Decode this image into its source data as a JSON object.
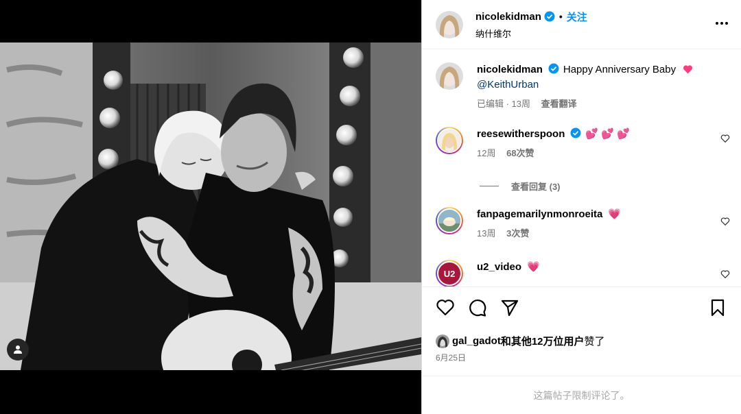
{
  "post": {
    "author": "nicolekidman",
    "follow_label": "关注",
    "location": "纳什维尔",
    "caption_text": "Happy Anniversary Baby",
    "caption_mention": "@KeithUrban",
    "caption_meta_edited": "已编辑 · 13周",
    "caption_meta_translate": "查看翻译",
    "separator_dot": "•"
  },
  "comments": [
    {
      "user": "reesewitherspoon",
      "text": "💕 💕 💕",
      "age": "12周",
      "likes": "68次赞",
      "replies": "查看回复 (3)"
    },
    {
      "user": "fanpagemarilynmonroeita",
      "text": "💗",
      "age": "13周",
      "likes": "3次赞"
    },
    {
      "user": "u2_video",
      "text": "💗",
      "avatar_text": "U2"
    }
  ],
  "likes": {
    "user": "gal_gadot",
    "suffix": "和其他12万位用户赞了",
    "date": "6月25日"
  },
  "footer": {
    "text": "这篇帖子限制评论了。"
  },
  "colors": {
    "accent": "#0095f6",
    "verified": "#0095f6",
    "heart": "#ff3040",
    "muted": "#737373"
  },
  "icons": [
    "user-tag-icon",
    "verified-icon",
    "more-icon",
    "heart-icon",
    "comment-icon",
    "share-icon",
    "bookmark-icon"
  ]
}
